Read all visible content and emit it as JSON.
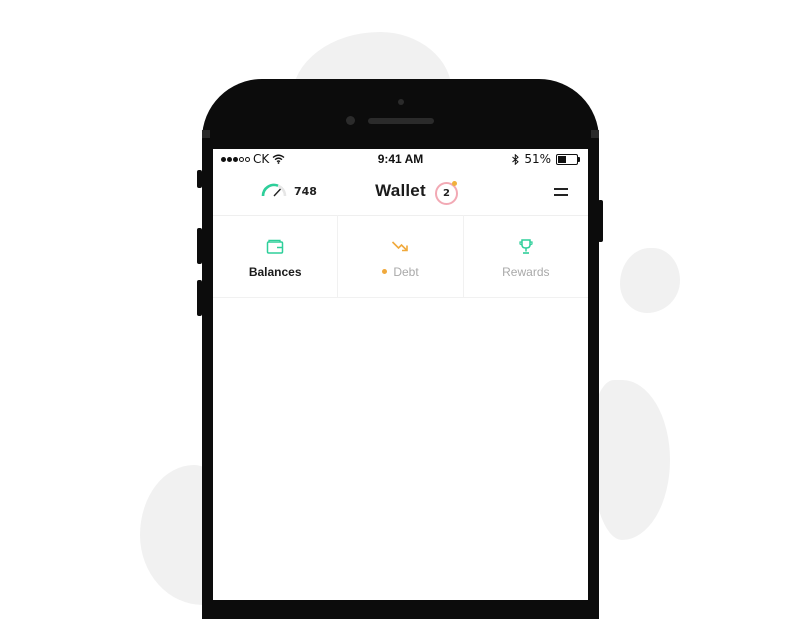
{
  "status_bar": {
    "carrier": "CK",
    "time": "9:41 AM",
    "battery_percent": "51%",
    "battery_level": 0.51,
    "icons": [
      "signal-dots",
      "wifi-icon",
      "bluetooth-icon",
      "battery-icon"
    ]
  },
  "header": {
    "score": "748",
    "title": "Wallet",
    "notification_count": "2",
    "icons": [
      "gauge-icon",
      "hamburger-menu-icon"
    ]
  },
  "tabs": [
    {
      "label": "Balances",
      "icon": "wallet-icon",
      "active": true,
      "color": "#2ecf9a"
    },
    {
      "label": "Debt",
      "icon": "trend-down-icon",
      "active": false,
      "color": "#f0a93c"
    },
    {
      "label": "Rewards",
      "icon": "trophy-icon",
      "active": false,
      "color": "#2ecf9a"
    }
  ],
  "colors": {
    "accent_green": "#2ecf9a",
    "accent_orange": "#f0a93c",
    "badge_ring": "#f2a9b4"
  }
}
